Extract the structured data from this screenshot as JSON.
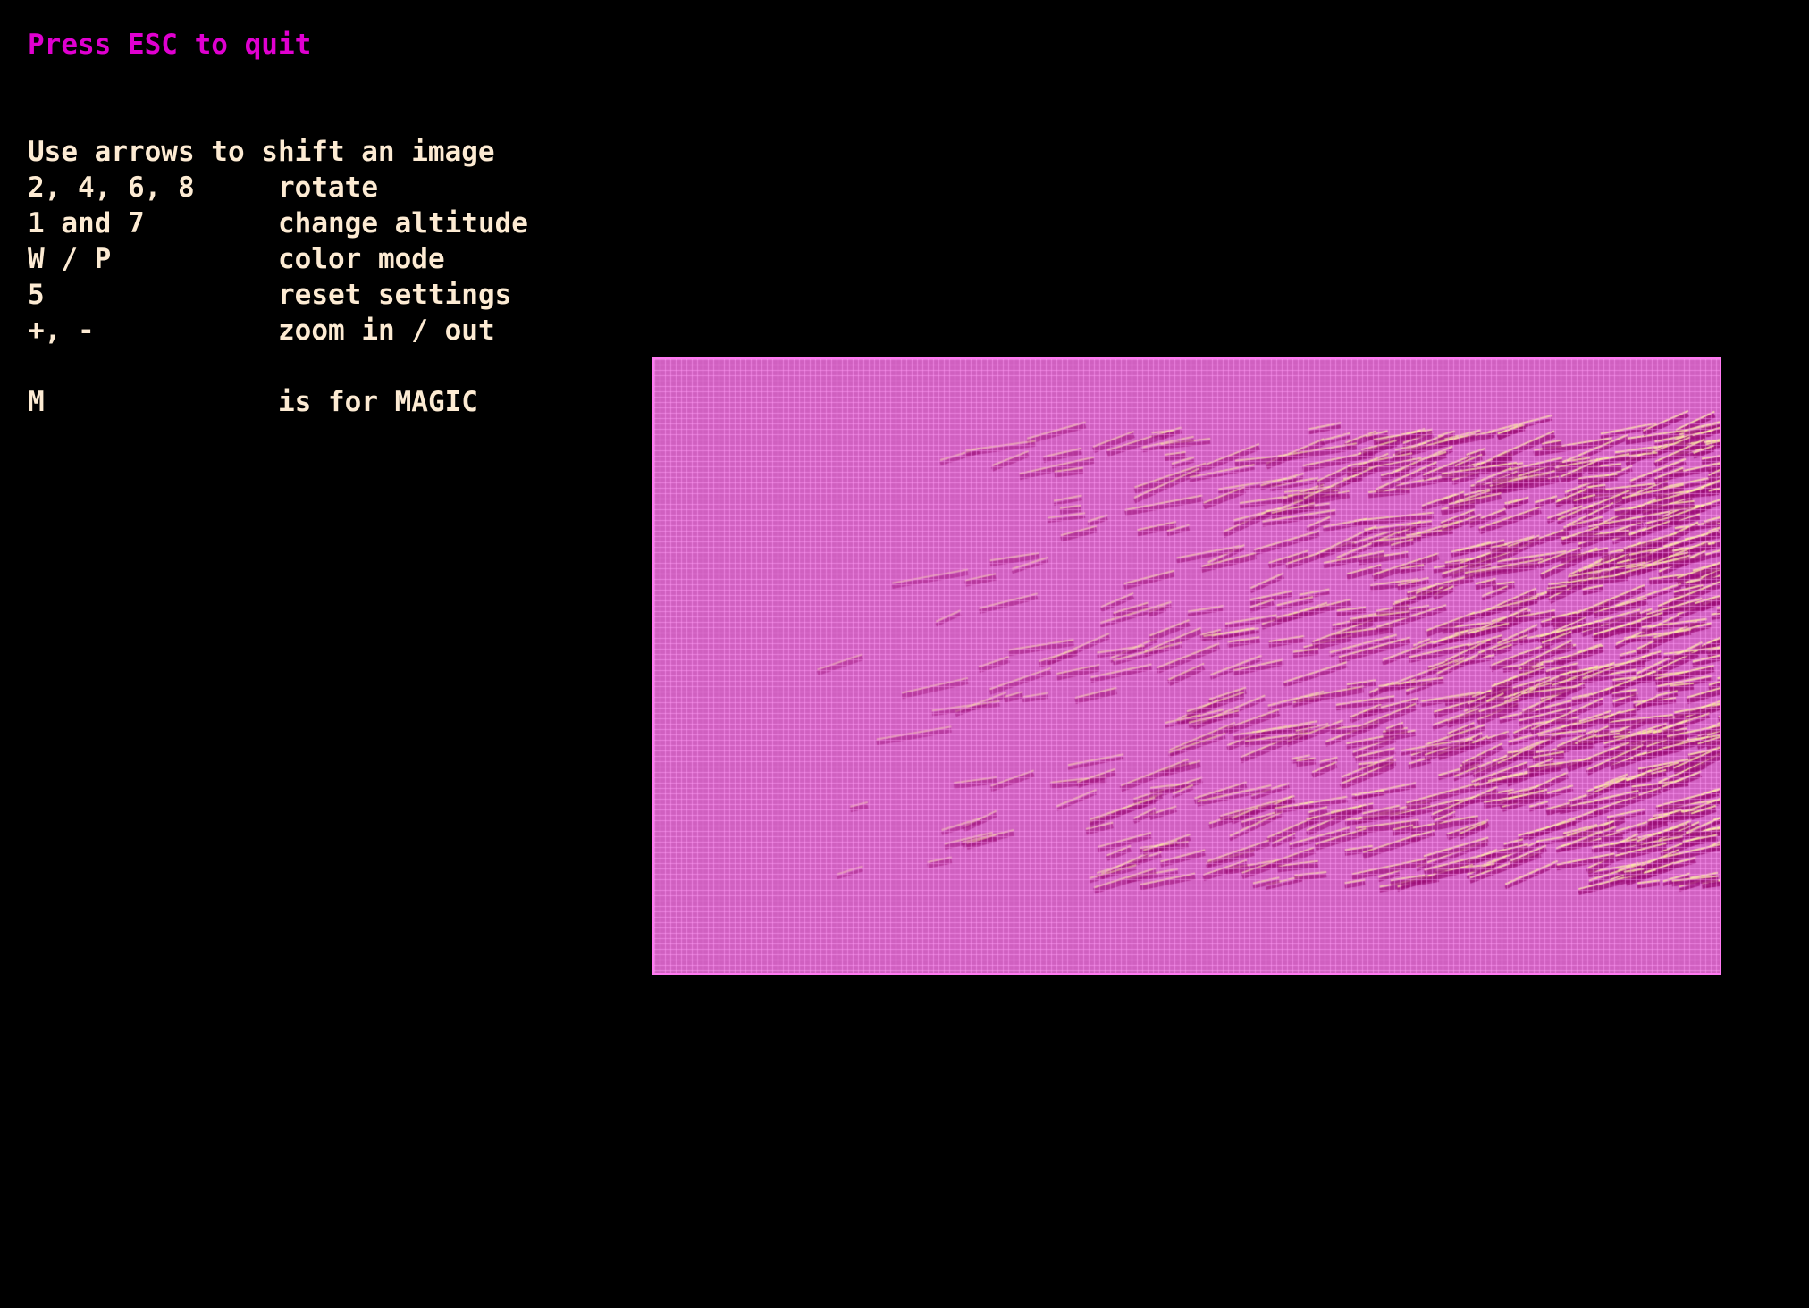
{
  "colors": {
    "background": "#000000",
    "hint_text": "#e000d0",
    "help_text": "#fdebd3",
    "grid_base": "#d060c0",
    "grid_line": "#ff9cf6",
    "ridge_dark": "#9c0f78",
    "ridge_light": "#fff1a8"
  },
  "hint": {
    "esc": "Press ESC to quit"
  },
  "help": {
    "shift": "Use arrows to shift an image",
    "rows": [
      {
        "key": "2, 4, 6, 8",
        "action": "rotate"
      },
      {
        "key": "1 and 7",
        "action": "change altitude"
      },
      {
        "key": "W / P",
        "action": "color mode"
      },
      {
        "key": "5",
        "action": "reset settings"
      },
      {
        "key": "+, -",
        "action": "zoom in / out"
      }
    ],
    "magic": {
      "key": "M",
      "action": "is for MAGIC"
    }
  },
  "render": {
    "icon": "wireframe-terrain-icon",
    "color_mode": "P"
  }
}
